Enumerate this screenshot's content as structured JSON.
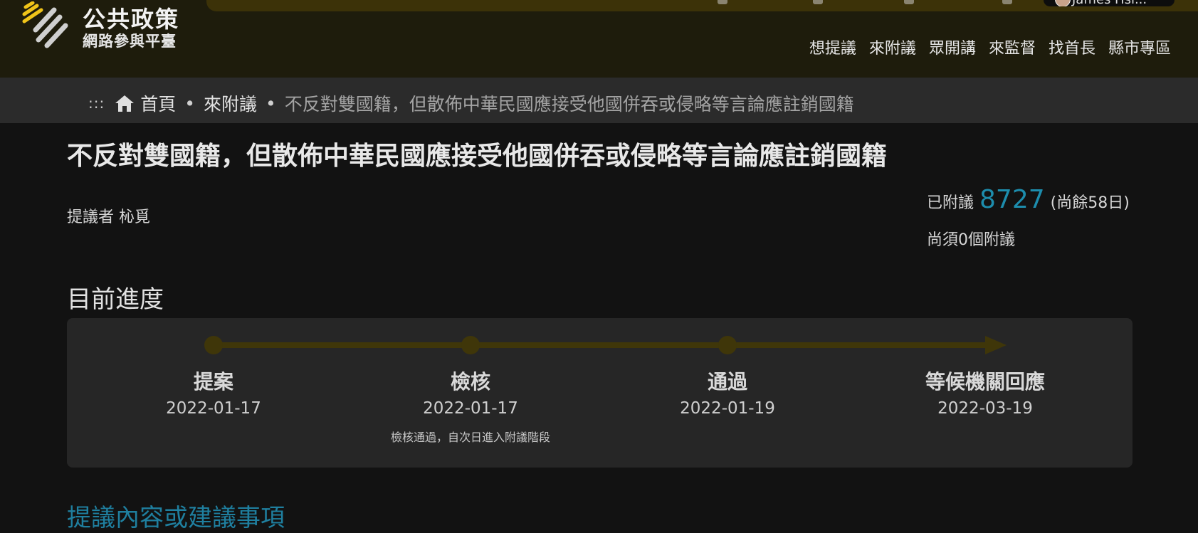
{
  "brand": {
    "title": "公共政策",
    "subtitle": "網路參與平臺",
    "accent_color": "#f0c419"
  },
  "user": {
    "name": "James Hsi..."
  },
  "nav": {
    "items": [
      "想提議",
      "來附議",
      "眾開講",
      "來監督",
      "找首長",
      "縣市專區"
    ]
  },
  "breadcrumb": {
    "dots": ":::",
    "home": "首頁",
    "section": "來附議",
    "current": "不反對雙國籍，但散佈中華民國應接受他國併吞或侵略等言論應註銷國籍",
    "separator": "•"
  },
  "proposal": {
    "title": "不反對雙國籍，但散佈中華民國應接受他國併吞或侵略等言論應註銷國籍",
    "proposer_label": "提議者",
    "proposer_name": "杺覓",
    "endorsed_label": "已附議",
    "endorsed_count": "8727",
    "days_left": "(尚餘58日)",
    "needed": "尚須0個附議",
    "count_color": "#1d8dad"
  },
  "progress": {
    "heading": "目前進度",
    "track_color": "#3f3609",
    "steps": [
      {
        "label": "提案",
        "date": "2022-01-17",
        "note": ""
      },
      {
        "label": "檢核",
        "date": "2022-01-17",
        "note": "檢核通過，自次日進入附議階段"
      },
      {
        "label": "通過",
        "date": "2022-01-19",
        "note": ""
      },
      {
        "label": "等候機關回應",
        "date": "2022-03-19",
        "note": ""
      }
    ]
  },
  "next_section": {
    "heading": "提議內容或建議事項"
  }
}
